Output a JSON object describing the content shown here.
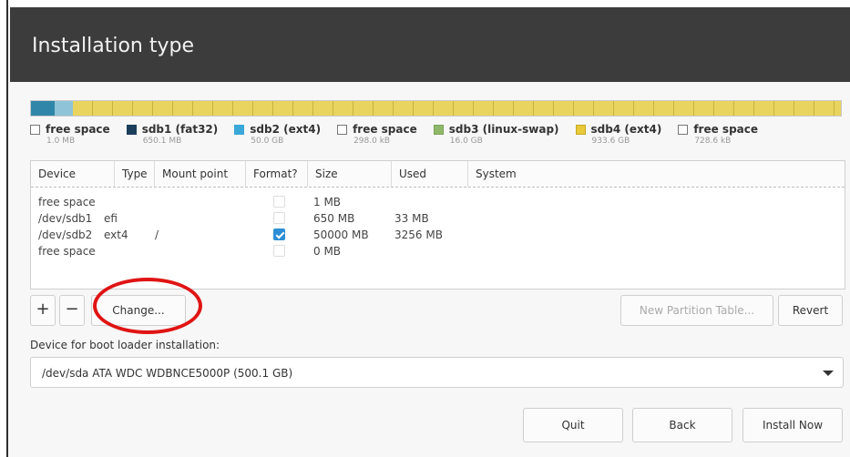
{
  "window": {
    "title": "Installation type"
  },
  "legend": [
    {
      "key": "free",
      "name": "free space",
      "size": "1.0 MB"
    },
    {
      "key": "fat",
      "name": "sdb1 (fat32)",
      "size": "650.1 MB"
    },
    {
      "key": "ext",
      "name": "sdb2 (ext4)",
      "size": "50.0 GB"
    },
    {
      "key": "free",
      "name": "free space",
      "size": "298.0 kB"
    },
    {
      "key": "swap",
      "name": "sdb3 (linux-swap)",
      "size": "16.0 GB"
    },
    {
      "key": "ext4",
      "name": "sdb4 (ext4)",
      "size": "933.6 GB"
    },
    {
      "key": "free",
      "name": "free space",
      "size": "728.6 kB"
    }
  ],
  "table": {
    "headers": [
      "Device",
      "Type",
      "Mount point",
      "Format?",
      "Size",
      "Used",
      "System"
    ],
    "rows": [
      {
        "device": "free space",
        "type": "",
        "mount": "",
        "format": false,
        "size": "1 MB",
        "used": ""
      },
      {
        "device": "/dev/sdb1",
        "type": "efi",
        "mount": "",
        "format": false,
        "size": "650 MB",
        "used": "33 MB"
      },
      {
        "device": "/dev/sdb2",
        "type": "ext4",
        "mount": "/",
        "format": true,
        "size": "50000 MB",
        "used": "3256 MB"
      },
      {
        "device": "free space",
        "type": "",
        "mount": "",
        "format": false,
        "size": "0 MB",
        "used": ""
      }
    ]
  },
  "toolbar": {
    "add": "+",
    "remove": "−",
    "change": "Change...",
    "new_table": "New Partition Table...",
    "revert": "Revert"
  },
  "bootloader": {
    "label": "Device for boot loader installation:",
    "selected": "/dev/sda   ATA WDC WDBNCE5000P (500.1 GB)"
  },
  "footer": {
    "quit": "Quit",
    "back": "Back",
    "install": "Install Now"
  },
  "colors": {
    "header_bg": "#3c3c3c",
    "checkbox_on": "#2d8ed6",
    "annotation": "#e01414"
  }
}
